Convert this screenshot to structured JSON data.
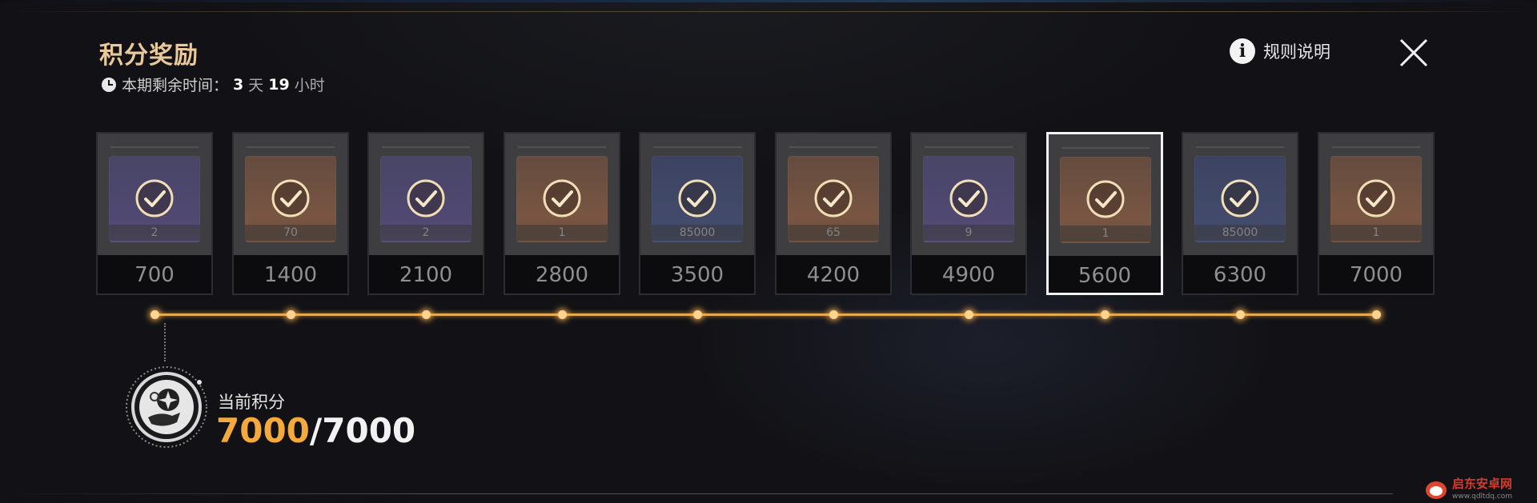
{
  "header": {
    "title": "积分奖励",
    "remaining_label": "本期剩余时间：",
    "remaining_days": "3",
    "days_unit": "天",
    "remaining_hours": "19",
    "hours_unit": "小时",
    "rules_label": "规则说明"
  },
  "rewards": [
    {
      "quantity": "2",
      "points": "700",
      "theme": "purple",
      "claimed": true,
      "selected": false
    },
    {
      "quantity": "70",
      "points": "1400",
      "theme": "orange",
      "claimed": true,
      "selected": false
    },
    {
      "quantity": "2",
      "points": "2100",
      "theme": "purple",
      "claimed": true,
      "selected": false
    },
    {
      "quantity": "1",
      "points": "2800",
      "theme": "orange",
      "claimed": true,
      "selected": false
    },
    {
      "quantity": "85000",
      "points": "3500",
      "theme": "blue",
      "claimed": true,
      "selected": false
    },
    {
      "quantity": "65",
      "points": "4200",
      "theme": "orange",
      "claimed": true,
      "selected": false
    },
    {
      "quantity": "9",
      "points": "4900",
      "theme": "purple",
      "claimed": true,
      "selected": false
    },
    {
      "quantity": "1",
      "points": "5600",
      "theme": "orange",
      "claimed": true,
      "selected": true
    },
    {
      "quantity": "85000",
      "points": "6300",
      "theme": "blue",
      "claimed": true,
      "selected": false
    },
    {
      "quantity": "1",
      "points": "7000",
      "theme": "orange",
      "claimed": true,
      "selected": false
    }
  ],
  "progress": {
    "current_label": "当前积分",
    "current": "7000",
    "separator": "/",
    "max": "7000",
    "fraction": 1.0
  },
  "watermark": {
    "name": "启东安卓网",
    "site": "www.qdltdq.com"
  },
  "colors": {
    "accent_gold": "#e9c99a",
    "score_orange": "#f3a93c",
    "track": "#e4a84e",
    "purple": "#3a2a66",
    "orange": "#6a3b1e",
    "blue": "#1f2a55"
  },
  "icons": {
    "clock": "clock-icon",
    "info": "info-icon",
    "close": "close-icon",
    "check": "check-circle-icon",
    "badge": "points-badge-icon"
  }
}
